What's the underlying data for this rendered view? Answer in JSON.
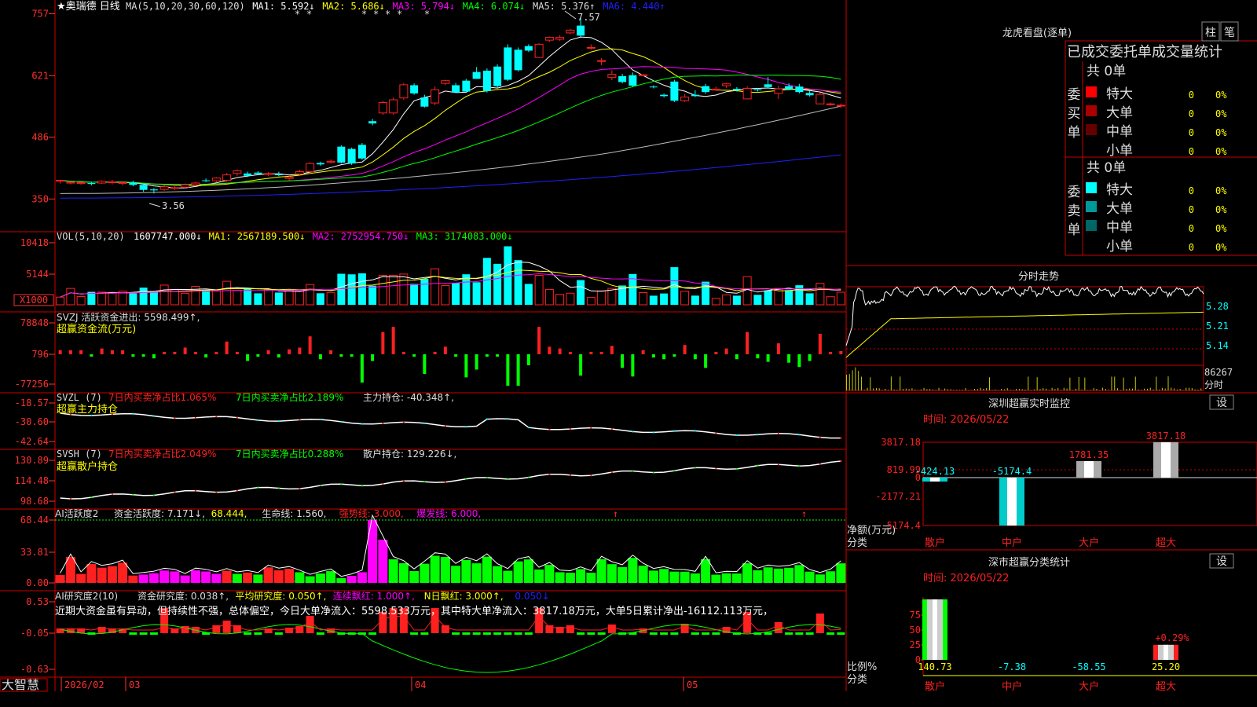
{
  "colors": {
    "red": "#ff2020",
    "cyan": "#00ffff",
    "white": "#ffffff",
    "yellow": "#ffff00",
    "magenta": "#ff00ff",
    "green": "#00ff00",
    "blue": "#2020ff",
    "darkred": "#aa0000",
    "grid": "#cc0000",
    "axis": "#ff3030",
    "olive": "#c8c800"
  },
  "chart_data": [
    {
      "type": "candlestick",
      "title": "★奥瑞德 日线",
      "ylabel": "",
      "yticks": [
        "757",
        "621",
        "486",
        "350"
      ],
      "ylim": [
        335,
        770
      ],
      "ma_legend": [
        "MA(5,10,20,30,60,120)",
        "MA1: 5.592↓",
        "MA2: 5.686↓",
        "MA3: 5.794↓",
        "MA4: 6.074↓",
        "MA5: 5.376↑",
        "MA6: 4.440↑"
      ],
      "annotations": [
        "7.57",
        "3.56"
      ],
      "x_ticks": [
        "2026/02",
        "03",
        "04",
        "05"
      ],
      "candles": [
        [
          389,
          391,
          384,
          392
        ],
        [
          385,
          387,
          382,
          388
        ],
        [
          384,
          386,
          381,
          387
        ],
        [
          385,
          383,
          380,
          388
        ],
        [
          385,
          389,
          383,
          391
        ],
        [
          386,
          388,
          382,
          392
        ],
        [
          384,
          386,
          380,
          389
        ],
        [
          386,
          381,
          378,
          390
        ],
        [
          381,
          370,
          366,
          384
        ],
        [
          371,
          369,
          362,
          374
        ],
        [
          371,
          377,
          368,
          380
        ],
        [
          373,
          375,
          370,
          378
        ],
        [
          376,
          381,
          373,
          384
        ],
        [
          381,
          385,
          378,
          388
        ],
        [
          391,
          390,
          387,
          395
        ],
        [
          390,
          396,
          386,
          398
        ],
        [
          391,
          403,
          388,
          407
        ],
        [
          406,
          412,
          401,
          415
        ],
        [
          406,
          401,
          398,
          410
        ],
        [
          408,
          405,
          402,
          411
        ],
        [
          404,
          406,
          400,
          409
        ],
        [
          404,
          403,
          400,
          410
        ],
        [
          395,
          398,
          391,
          401
        ],
        [
          405,
          410,
          402,
          414
        ],
        [
          410,
          428,
          406,
          431
        ],
        [
          429,
          426,
          423,
          432
        ],
        [
          431,
          433,
          428,
          437
        ],
        [
          465,
          430,
          428,
          468
        ],
        [
          460,
          428,
          425,
          463
        ],
        [
          469,
          439,
          436,
          473
        ],
        [
          521,
          516,
          512,
          526
        ],
        [
          539,
          562,
          535,
          566
        ],
        [
          539,
          568,
          535,
          573
        ],
        [
          572,
          601,
          568,
          605
        ],
        [
          600,
          582,
          579,
          604
        ],
        [
          573,
          553,
          551,
          579
        ],
        [
          561,
          590,
          556,
          597
        ],
        [
          604,
          610,
          600,
          612
        ],
        [
          600,
          584,
          584,
          605
        ],
        [
          610,
          586,
          586,
          614
        ],
        [
          629,
          614,
          614,
          640
        ],
        [
          632,
          587,
          584,
          637
        ],
        [
          641,
          598,
          595,
          646
        ],
        [
          683,
          612,
          609,
          690
        ],
        [
          678,
          633,
          630,
          683
        ],
        [
          686,
          676,
          673,
          690
        ],
        [
          661,
          690,
          660,
          692
        ],
        [
          699,
          705,
          695,
          707
        ],
        [
          701,
          705,
          697,
          710
        ],
        [
          715,
          721,
          712,
          724
        ],
        [
          731,
          709,
          706,
          748
        ],
        [
          683,
          683,
          678,
          690
        ],
        [
          654,
          654,
          644,
          660
        ],
        [
          617,
          624,
          611,
          633
        ],
        [
          620,
          607,
          604,
          625
        ],
        [
          622,
          599,
          596,
          628
        ],
        [
          621,
          623,
          621,
          624
        ],
        [
          597,
          596,
          593,
          600
        ],
        [
          579,
          576,
          573,
          582
        ],
        [
          608,
          566,
          563,
          612
        ],
        [
          566,
          574,
          563,
          580
        ],
        [
          579,
          576,
          574,
          589
        ],
        [
          598,
          585,
          581,
          603
        ],
        [
          591,
          591,
          588,
          597
        ],
        [
          599,
          603,
          594,
          605
        ],
        [
          592,
          589,
          586,
          596
        ],
        [
          570,
          593,
          569,
          598
        ],
        [
          591,
          589,
          586,
          594
        ],
        [
          602,
          596,
          593,
          618
        ],
        [
          582,
          592,
          570,
          599
        ],
        [
          598,
          591,
          589,
          604
        ],
        [
          597,
          585,
          582,
          603
        ],
        [
          583,
          578,
          575,
          588
        ],
        [
          559,
          580,
          558,
          584
        ],
        [
          559,
          559,
          555,
          562
        ],
        [
          555,
          556,
          550,
          560
        ]
      ]
    },
    {
      "type": "bar",
      "title": "VOL(5,10,20)",
      "legend": [
        "1607747.000↓",
        "MA1: 2567189.500↓",
        "MA2: 2752954.750↓",
        "MA3: 3174083.000↓"
      ],
      "yticks": [
        "10418",
        "5144",
        "X1000"
      ]
    },
    {
      "type": "bar",
      "title": "SVZJ 活跃资金进出: 5598.499↑,",
      "subtitle": "超赢资金流(万元)",
      "yticks": [
        "78848",
        "796",
        "-77256"
      ]
    },
    {
      "type": "line",
      "title": "SVZL (7)",
      "legend": [
        "7日内买卖净占比1.065%",
        "7日内买卖净占比2.189%",
        "主力持仓: -40.348↑,"
      ],
      "subtitle": "超赢主力持仓",
      "yticks": [
        "-18.57",
        "-30.60",
        "-42.64"
      ]
    },
    {
      "type": "line",
      "title": "SVSH (7)",
      "legend": [
        "7日内买卖净占比2.049%",
        "7日内买卖净占比0.288%",
        "散户持仓: 129.226↓,"
      ],
      "subtitle": "超赢散户持仓",
      "yticks": [
        "130.89",
        "114.48",
        "98.68"
      ]
    },
    {
      "type": "bar",
      "title": "AI活跃度2",
      "legend": [
        "资金活跃度: 7.171↓,",
        "68.444,",
        "生命线: 1.560,",
        "强势线: 3.000,",
        "爆发线: 6.000,"
      ],
      "yticks": [
        "68.44",
        "33.81",
        "0.00"
      ]
    },
    {
      "type": "bar",
      "title": "AI研究度2(10)",
      "legend": [
        "资金研究度: 0.038↑,",
        "平均研究度: 0.050↑,",
        "连续飘红: 1.000↑,",
        "N日飘红: 3.000↑,",
        "0.050↓"
      ],
      "yticks": [
        "0.53",
        "-0.05",
        "-0.63"
      ],
      "annotation": "近期大资金虽有异动，但持续性不强，总体偏空，今日大单净流入：5598.533万元，其中特大单净流入：3817.18万元，大单5日累计净出-16112.113万元，"
    }
  ],
  "right": {
    "lhkp_title": "龙虎看盘(逐单)",
    "btn_zhu": "柱",
    "btn_bi": "笔",
    "stat_title": "已成交委托单成交量统计",
    "buy_label": "委买单",
    "sell_label": "委卖单",
    "buy_total": "共 0单",
    "sell_total": "共 0单",
    "buy_rows": [
      {
        "name": "特大",
        "v": "0",
        "p": "0%",
        "c": "#ff0000"
      },
      {
        "name": "大单",
        "v": "0",
        "p": "0%",
        "c": "#aa0000"
      },
      {
        "name": "中单",
        "v": "0",
        "p": "0%",
        "c": "#660000"
      },
      {
        "name": "小单",
        "v": "0",
        "p": "0%",
        "c": ""
      }
    ],
    "sell_rows": [
      {
        "name": "特大",
        "v": "0",
        "p": "0%",
        "c": "#00ffff"
      },
      {
        "name": "大单",
        "v": "0",
        "p": "0%",
        "c": "#009999"
      },
      {
        "name": "中单",
        "v": "0",
        "p": "0%",
        "c": "#006666"
      },
      {
        "name": "小单",
        "v": "0",
        "p": "0%",
        "c": ""
      }
    ],
    "fs_title": "分时走势",
    "fs_ticks": [
      "5.28",
      "5.21",
      "5.14"
    ],
    "fs_vol": "86267",
    "fs_vol_label": "分时",
    "sz_title": "深圳超赢实时监控",
    "time": "时间: 2026/05/22",
    "set": "设",
    "sz_yticks": [
      "3817.18",
      "819.99",
      "0",
      "-2177.21",
      "-5174.4"
    ],
    "sz_axis_label": "净额(万元)",
    "sz_cat_label": "分类",
    "sz_bars": [
      {
        "cat": "散户",
        "v": -424.13,
        "label": "-424.13"
      },
      {
        "cat": "中户",
        "v": -5174.4,
        "label": "-5174.4"
      },
      {
        "cat": "大户",
        "v": 1781.35,
        "label": "1781.35"
      },
      {
        "cat": "超大",
        "v": 3817.18,
        "label": "3817.18"
      }
    ],
    "sc_title": "深市超赢分类统计",
    "sc_yticks": [
      "75",
      "50",
      "25",
      "0"
    ],
    "sc_axis_label": "比例%",
    "sc_cat_label": "分类",
    "sc_bars": [
      {
        "cat": "散户",
        "v": 140.73,
        "label": "140.73"
      },
      {
        "cat": "中户",
        "v": -7.38,
        "label": "-7.38"
      },
      {
        "cat": "大户",
        "v": -58.55,
        "label": "-58.55"
      },
      {
        "cat": "超大",
        "v": 25.2,
        "label": "25.20"
      }
    ],
    "sc_pct": "+0.29%"
  },
  "bottom": {
    "logo": "大智慧"
  }
}
